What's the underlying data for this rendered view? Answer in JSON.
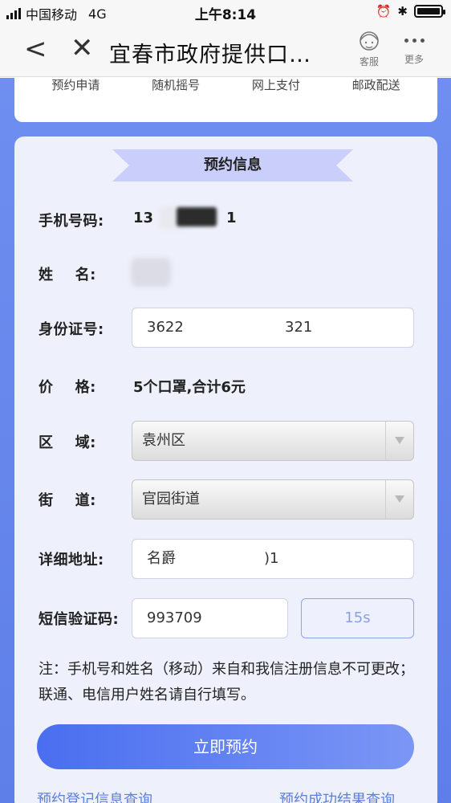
{
  "status_bar": {
    "carrier": "中国移动",
    "network": "4G",
    "time": "上午8:14"
  },
  "nav": {
    "title": "宜春市政府提供口…",
    "service_label": "客服",
    "more_label": "更多"
  },
  "steps": [
    "预约申请",
    "随机摇号",
    "网上支付",
    "邮政配送"
  ],
  "form": {
    "section_title": "预约信息",
    "phone": {
      "label": "手机号码:",
      "value_start": "13",
      "value_end": "1"
    },
    "name": {
      "label": "姓    名:"
    },
    "id_number": {
      "label": "身份证号:",
      "value_start": "3622",
      "value_end": "321"
    },
    "price": {
      "label": "价    格:",
      "value": "5个口罩,合计6元"
    },
    "district": {
      "label": "区    域:",
      "value": "袁州区"
    },
    "street": {
      "label": "街    道:",
      "value": "官园街道"
    },
    "address": {
      "label": "详细地址:",
      "value_start": "名爵",
      "value_end": ")1"
    },
    "sms_code": {
      "label": "短信验证码:",
      "value": "993709",
      "countdown": "15s"
    },
    "note": "注：手机号和姓名（移动）来自和我信注册信息不可更改；联通、电信用户姓名请自行填写。",
    "submit_label": "立即预约"
  },
  "links": {
    "left": "预约登记信息查询",
    "right": "预约成功结果查询"
  },
  "colors": {
    "page_gradient": "#6f8ef0",
    "button": "#4a6ef0",
    "link": "#5f7fdc",
    "ribbon": "#c9cffa"
  }
}
